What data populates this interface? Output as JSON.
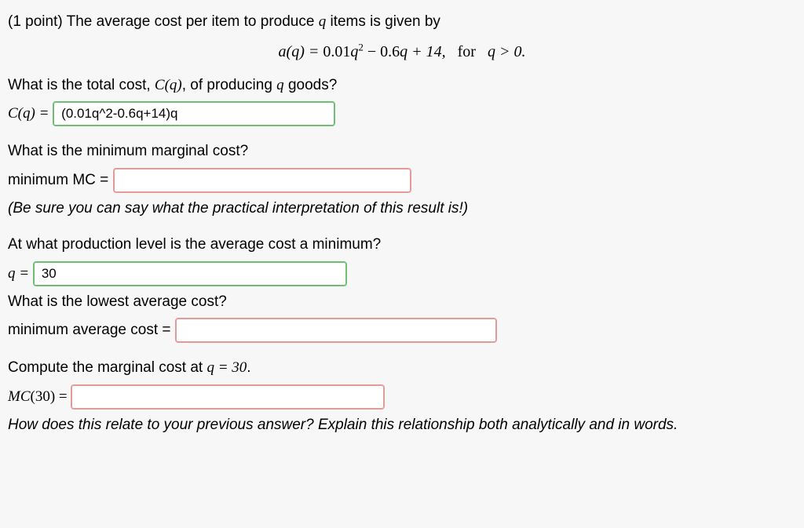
{
  "intro": {
    "points": "(1 point) The average cost per item to produce ",
    "q": "q",
    "after": " items is given by"
  },
  "equation": {
    "lhs": "a(q) = ",
    "coef1": "0.01",
    "term1": "q",
    "exp1": "2",
    "minus": " − ",
    "coef2": "0.6",
    "term2": "q + 14,",
    "for": "for",
    "cond": "q > 0."
  },
  "q1": {
    "prompt_a": "What is the total cost, ",
    "Cq": "C(q)",
    "prompt_b": ", of producing ",
    "q": "q",
    "prompt_c": " goods?",
    "lhs": "C(q) = ",
    "value": "(0.01q^2-0.6q+14)q"
  },
  "q2": {
    "prompt": "What is the minimum marginal cost?",
    "lhs": "minimum MC = ",
    "value": "",
    "hint": "(Be sure you can say what the practical interpretation of this result is!)"
  },
  "q3": {
    "prompt": "At what production level is the average cost a minimum?",
    "lhs": "q = ",
    "value": "30"
  },
  "q4": {
    "prompt": "What is the lowest average cost?",
    "lhs": "minimum average cost = ",
    "value": ""
  },
  "q5": {
    "prompt_a": "Compute the marginal cost at ",
    "cond": "q = 30",
    "dot": ".",
    "lhs": "MC(30) = ",
    "value": "",
    "footer": "How does this relate to your previous answer? Explain this relationship both analytically and in words."
  }
}
